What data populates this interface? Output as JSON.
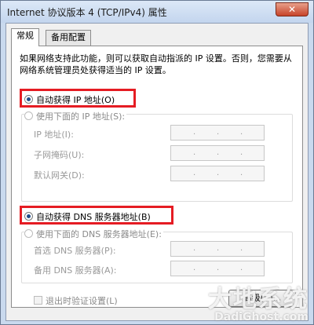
{
  "window": {
    "title": "Internet 协议版本 4 (TCP/IPv4) 属性",
    "close_label": "✕"
  },
  "tabs": [
    {
      "label": "常规",
      "active": true
    },
    {
      "label": "备用配置",
      "active": false
    }
  ],
  "description": "如果网络支持此功能，则可以获取自动指派的 IP 设置。否则，您需要从网络系统管理员处获得适当的 IP 设置。",
  "ip_section": {
    "auto_label": "自动获得 IP 地址(O)",
    "manual_label": "使用下面的 IP 地址(S):",
    "fields": [
      {
        "label": "IP 地址(I):"
      },
      {
        "label": "子网掩码(U):"
      },
      {
        "label": "默认网关(D):"
      }
    ]
  },
  "dns_section": {
    "auto_label": "自动获得 DNS 服务器地址(B)",
    "manual_label": "使用下面的 DNS 服务器地址(E):",
    "fields": [
      {
        "label": "首选 DNS 服务器(P):"
      },
      {
        "label": "备用 DNS 服务器(A):"
      }
    ]
  },
  "validate_label": "退出时验证设置(L)",
  "advanced_button": "高级(V)...",
  "ip_separator": ".",
  "watermark": {
    "cn": "大地系统",
    "en": "DadiGhost.com"
  },
  "colors": {
    "highlight": "#e51c23",
    "title_bar": "#c9d9ee"
  }
}
